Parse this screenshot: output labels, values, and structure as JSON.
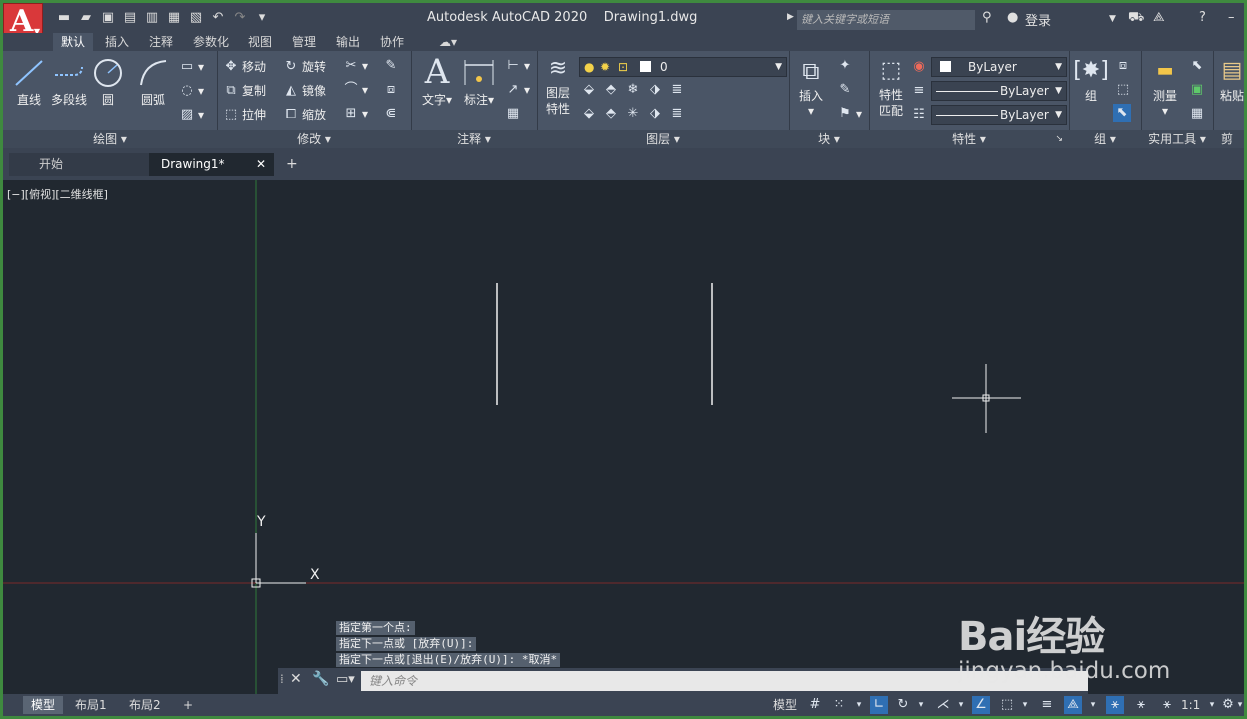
{
  "app_title": "Autodesk AutoCAD 2020",
  "file_name": "Drawing1.dwg",
  "search": {
    "placeholder": "键入关键字或短语"
  },
  "account": {
    "login_label": "登录"
  },
  "ribbon_tabs": [
    "默认",
    "插入",
    "注释",
    "参数化",
    "视图",
    "管理",
    "输出",
    "协作"
  ],
  "panels": {
    "draw": {
      "title": "绘图",
      "line": "直线",
      "polyline": "多段线",
      "circle": "圆",
      "arc": "圆弧"
    },
    "modify": {
      "title": "修改",
      "move": "移动",
      "rotate": "旋转",
      "copy": "复制",
      "mirror": "镜像",
      "stretch": "拉伸",
      "scale": "缩放"
    },
    "annotation": {
      "title": "注释",
      "text": "文字",
      "dimension": "标注"
    },
    "layers": {
      "title": "图层",
      "layer_props": "图层\n特性",
      "current_layer": "0"
    },
    "block": {
      "title": "块",
      "insert": "插入"
    },
    "properties": {
      "title": "特性",
      "match": "特性\n匹配",
      "color": "ByLayer",
      "linetype": "ByLayer",
      "lineweight": "ByLayer"
    },
    "groups": {
      "title": "组",
      "group": "组"
    },
    "utilities": {
      "title": "实用工具",
      "measure": "测量"
    },
    "clipboard": {
      "title": "剪",
      "paste": "粘贴"
    }
  },
  "file_tabs": {
    "start": "开始",
    "drawing": "Drawing1*",
    "close": "✕",
    "new": "+"
  },
  "viewport_label": "[−][俯视][二维线框]",
  "ucs": {
    "x": "X",
    "y": "Y"
  },
  "command_history": [
    "指定第一个点:",
    "指定下一点或 [放弃(U)]:",
    "指定下一点或[退出(E)/放弃(U)]: *取消*"
  ],
  "command_input": {
    "placeholder": "键入命令"
  },
  "layout_tabs": [
    "模型",
    "布局1",
    "布局2"
  ],
  "status": {
    "model": "模型",
    "scale": "1:1"
  },
  "watermark": {
    "logo": "Bai经验",
    "url": "jingyan.baidu.com"
  }
}
